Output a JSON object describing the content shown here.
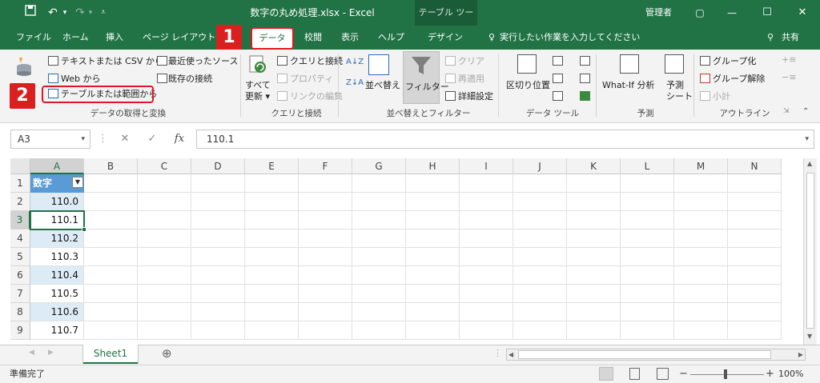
{
  "titlebar": {
    "save_icon": "save-icon",
    "undo_icon": "undo-icon",
    "redo_icon": "redo-icon",
    "customize_icon": "customize-qat-icon",
    "title": "数字の丸め処理.xlsx  -  Excel",
    "contextual_group": "テーブル ツール",
    "user": "管理者",
    "ribbon_display": "▢",
    "minimize": "—",
    "maximize": "☐",
    "close": "✕"
  },
  "tabs": {
    "file": "ファイル",
    "home": "ホーム",
    "insert": "挿入",
    "page_layout": "ページ レイアウト",
    "data": "データ",
    "review": "校閲",
    "view": "表示",
    "help": "ヘルプ",
    "design": "デザイン",
    "tell_me": "実行したい作業を入力してください",
    "share": "共有"
  },
  "badges": {
    "one": "1",
    "two": "2"
  },
  "ribbon": {
    "get_data": {
      "from_text_csv": "テキストまたは CSV から",
      "recent_sources": "最近使ったソース",
      "from_web": "Web から",
      "existing_connections": "既存の接続",
      "from_table": "テーブルまたは範囲から",
      "group_label": "データの取得と変換"
    },
    "queries": {
      "refresh_all_line1": "すべて",
      "refresh_all_line2": "更新 ▾",
      "queries_connections": "クエリと接続",
      "properties": "プロパティ",
      "edit_links": "リンクの編集",
      "group_label": "クエリと接続"
    },
    "sort_filter": {
      "sort": "並べ替え",
      "filter": "フィルター",
      "clear": "クリア",
      "reapply": "再適用",
      "advanced": "詳細設定",
      "group_label": "並べ替えとフィルター"
    },
    "data_tools": {
      "text_to_columns": "区切り位置",
      "group_label": "データ ツール"
    },
    "forecast": {
      "what_if": "What-If 分析",
      "forecast_line1": "予測",
      "forecast_line2": "シート",
      "group_label": "予測"
    },
    "outline": {
      "group": "グループ化",
      "ungroup": "グループ解除",
      "subtotal": "小計",
      "group_label": "アウトライン"
    }
  },
  "formula_bar": {
    "name_box": "A3",
    "cancel": "✕",
    "enter": "✓",
    "fx": "fx",
    "value": "110.1"
  },
  "grid": {
    "columns": [
      "A",
      "B",
      "C",
      "D",
      "E",
      "F",
      "G",
      "H",
      "I",
      "J",
      "K",
      "L",
      "M",
      "N"
    ],
    "rows": [
      "1",
      "2",
      "3",
      "4",
      "5",
      "6",
      "7",
      "8",
      "9"
    ],
    "header_cell": "数字",
    "values": [
      "110.0",
      "110.1",
      "110.2",
      "110.3",
      "110.4",
      "110.5",
      "110.6",
      "110.7"
    ]
  },
  "sheets": {
    "active": "Sheet1",
    "add": "⊕"
  },
  "status": {
    "ready": "準備完了",
    "zoom": "100%"
  }
}
